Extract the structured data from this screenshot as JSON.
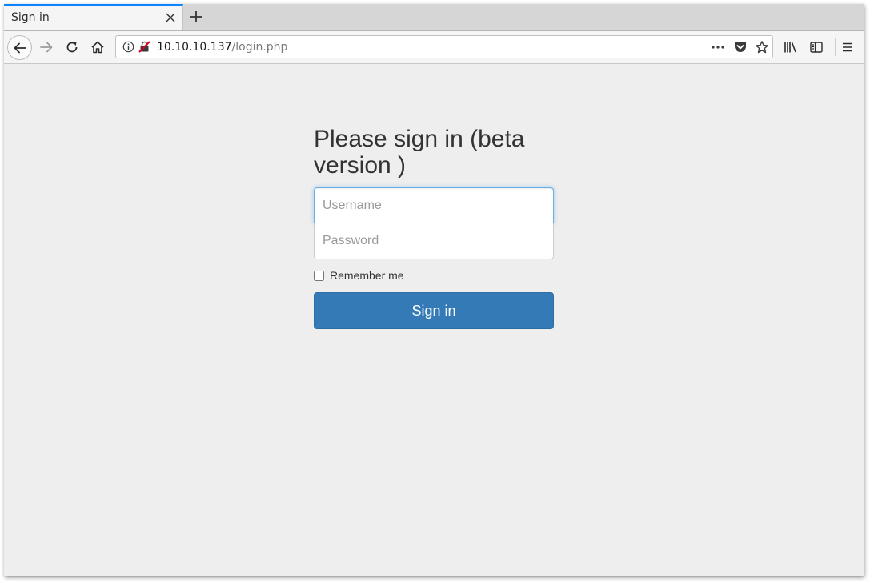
{
  "browser": {
    "tab": {
      "title": "Sign in"
    },
    "address": {
      "host": "10.10.10.137",
      "path": "/login.php"
    }
  },
  "page": {
    "heading": "Please sign in (beta version )",
    "username": {
      "placeholder": "Username",
      "value": ""
    },
    "password": {
      "placeholder": "Password",
      "value": ""
    },
    "remember_label": "Remember me",
    "remember_checked": false,
    "submit_label": "Sign in"
  },
  "colors": {
    "accent": "#0a84ff",
    "button": "#337ab7",
    "page_background": "#eeeeee"
  },
  "icons": [
    "close-icon",
    "plus-icon",
    "back-arrow-icon",
    "forward-arrow-icon",
    "reload-icon",
    "home-icon",
    "info-icon",
    "insecure-lock-icon",
    "more-actions-icon",
    "pocket-icon",
    "star-icon",
    "library-icon",
    "sidebar-icon",
    "hamburger-menu-icon"
  ]
}
